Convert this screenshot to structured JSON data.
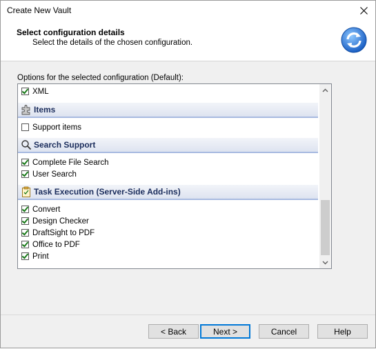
{
  "window": {
    "title": "Create New Vault"
  },
  "header": {
    "title": "Select configuration details",
    "subtitle": "Select the details of the chosen configuration."
  },
  "options": {
    "label": "Options for the selected configuration (Default):",
    "top_item": {
      "label": "XML",
      "checked": true
    },
    "sections": [
      {
        "label": "Items",
        "icon": "puzzle-icon",
        "items": [
          {
            "label": "Support items",
            "checked": false
          }
        ]
      },
      {
        "label": "Search Support",
        "icon": "magnifier-icon",
        "items": [
          {
            "label": "Complete File Search",
            "checked": true
          },
          {
            "label": "User Search",
            "checked": true
          }
        ]
      },
      {
        "label": "Task Execution (Server-Side Add-ins)",
        "icon": "clipboard-icon",
        "items": [
          {
            "label": "Convert",
            "checked": true
          },
          {
            "label": "Design Checker",
            "checked": true
          },
          {
            "label": "DraftSight to PDF",
            "checked": true
          },
          {
            "label": "Office to PDF",
            "checked": true
          },
          {
            "label": "Print",
            "checked": true
          }
        ]
      }
    ]
  },
  "buttons": {
    "back": "< Back",
    "next": "Next >",
    "cancel": "Cancel",
    "help": "Help"
  }
}
